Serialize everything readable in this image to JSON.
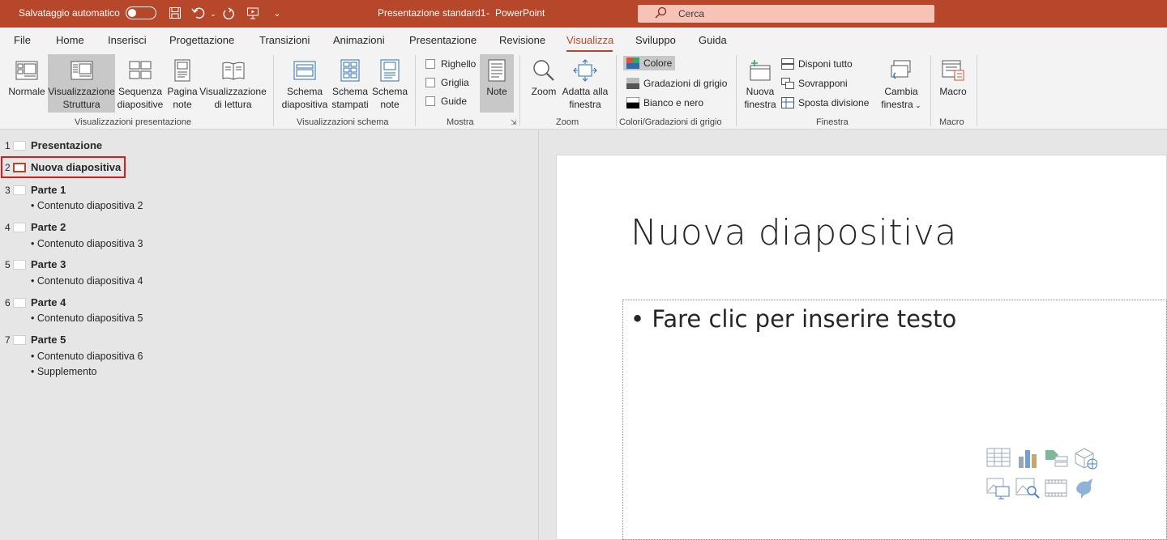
{
  "titlebar": {
    "autosave_label": "Salvataggio automatico",
    "document_title": "Presentazione standard1",
    "separator": "-",
    "app_name": "PowerPoint",
    "search_placeholder": "Cerca"
  },
  "tabs": [
    "File",
    "Home",
    "Inserisci",
    "Progettazione",
    "Transizioni",
    "Animazioni",
    "Presentazione",
    "Revisione",
    "Visualizza",
    "Sviluppo",
    "Guida"
  ],
  "active_tab": "Visualizza",
  "ribbon": {
    "views": {
      "normal": "Normale",
      "outline": [
        "Visualizzazione",
        "Struttura"
      ],
      "sorter": [
        "Sequenza",
        "diapositive"
      ],
      "notes_page": [
        "Pagina",
        "note"
      ],
      "reading": [
        "Visualizzazione",
        "di lettura"
      ],
      "group": "Visualizzazioni presentazione"
    },
    "master": {
      "slide_master": [
        "Schema",
        "diapositiva"
      ],
      "handout_master": [
        "Schema",
        "stampati"
      ],
      "notes_master": [
        "Schema",
        "note"
      ],
      "group": "Visualizzazioni schema"
    },
    "show": {
      "ruler": "Righello",
      "gridlines": "Griglia",
      "guides": "Guide",
      "notes": "Note",
      "group": "Mostra"
    },
    "zoom": {
      "zoom": "Zoom",
      "fit": [
        "Adatta alla",
        "finestra"
      ],
      "group": "Zoom"
    },
    "color": {
      "color": "Colore",
      "grayscale": "Gradazioni di grigio",
      "bw": "Bianco e nero",
      "group": "Colori/Gradazioni di grigio"
    },
    "window": {
      "new_window": [
        "Nuova",
        "finestra"
      ],
      "arrange_all": "Disponi tutto",
      "cascade": "Sovrapponi",
      "move_split": "Sposta divisione",
      "switch": [
        "Cambia",
        "finestra"
      ],
      "group": "Finestra"
    },
    "macros": {
      "macro": "Macro",
      "group": "Macro"
    }
  },
  "outline": [
    {
      "num": "1",
      "title": "Presentazione",
      "bullets": []
    },
    {
      "num": "2",
      "title": "Nuova diapositiva",
      "bullets": []
    },
    {
      "num": "3",
      "title": "Parte 1",
      "bullets": [
        "• Contenuto diapositiva 2"
      ]
    },
    {
      "num": "4",
      "title": "Parte 2",
      "bullets": [
        "• Contenuto diapositiva 3"
      ]
    },
    {
      "num": "5",
      "title": "Parte 3",
      "bullets": [
        "• Contenuto diapositiva 4"
      ]
    },
    {
      "num": "6",
      "title": "Parte 4",
      "bullets": [
        "• Contenuto diapositiva 5"
      ]
    },
    {
      "num": "7",
      "title": "Parte 5",
      "bullets": [
        "• Contenuto diapositiva 6",
        "• Supplemento"
      ]
    }
  ],
  "selected_slide": "2",
  "slide": {
    "title": "Nuova diapositiva",
    "body_placeholder": "Fare clic per inserire testo"
  },
  "colors": {
    "accent": "#b7472a",
    "highlight": "#e0191b"
  }
}
